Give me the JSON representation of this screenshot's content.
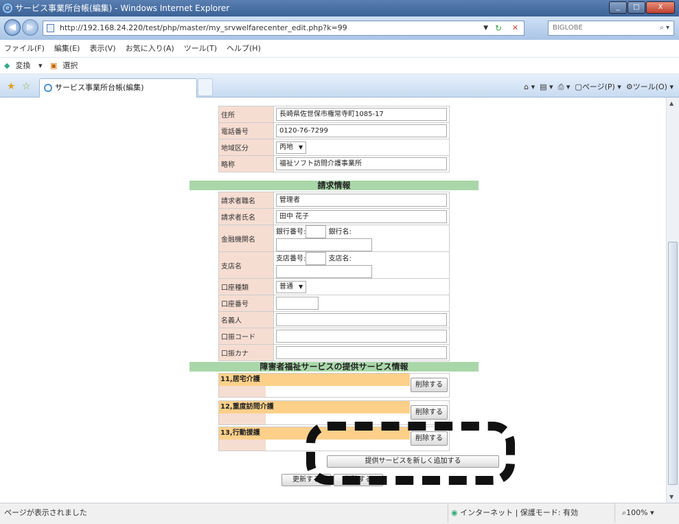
{
  "window": {
    "title": "サービス事業所台帳(編集) - Windows Internet Explorer",
    "buttons": [
      "_",
      "□",
      "X"
    ]
  },
  "address": {
    "url": "http://192.168.24.220/test/php/master/my_srvwelfarecenter_edit.php?k=99",
    "search_value": "BIGLOBE"
  },
  "menu": [
    "ファイル(F)",
    "編集(E)",
    "表示(V)",
    "お気に入り(A)",
    "ツール(T)",
    "ヘルプ(H)"
  ],
  "linkbar": {
    "convert": "変換",
    "select": "選択"
  },
  "tab": {
    "title": "サービス事業所台帳(編集)"
  },
  "cmdbar": {
    "page": "ページ(P)",
    "tools": "ツール(O)"
  },
  "basic_fields": [
    {
      "label": "住所",
      "value": "長崎県佐世保市権常寺町1085-17"
    },
    {
      "label": "電話番号",
      "value": "0120-76-7299"
    },
    {
      "label": "地域区分",
      "value": "丙地"
    },
    {
      "label": "略称",
      "value": "福祉ソフト訪問介護事業所"
    }
  ],
  "billing": {
    "section_title": "請求情報",
    "fields": [
      {
        "label": "請求者職名",
        "value": "管理者"
      },
      {
        "label": "請求者氏名",
        "value": "田中 花子"
      },
      {
        "label": "金融機関名",
        "sub1": "銀行番号:",
        "sub2": "銀行名:"
      },
      {
        "label": "支店名",
        "sub1": "支店番号:",
        "sub2": "支店名:"
      },
      {
        "label": "口座種類",
        "value": "普通"
      },
      {
        "label": "口座番号",
        "value": ""
      },
      {
        "label": "名義人",
        "value": ""
      },
      {
        "label": "口振コード",
        "value": ""
      },
      {
        "label": "口振カナ",
        "value": ""
      }
    ]
  },
  "services": {
    "section_title": "障害者福祉サービスの提供サービス情報",
    "items": [
      {
        "name": "11,居宅介護",
        "button": "削除する"
      },
      {
        "name": "12,重度訪問介護",
        "button": "削除する"
      },
      {
        "name": "13,行動援護",
        "button": "削除する"
      }
    ],
    "add_button": "提供サービスを新しく追加する",
    "update_button": "更新する",
    "delete_button": "削除する"
  },
  "status": {
    "text": "ページが表示されました",
    "zone": "インターネット | 保護モード: 有効",
    "zoom": "100%"
  }
}
